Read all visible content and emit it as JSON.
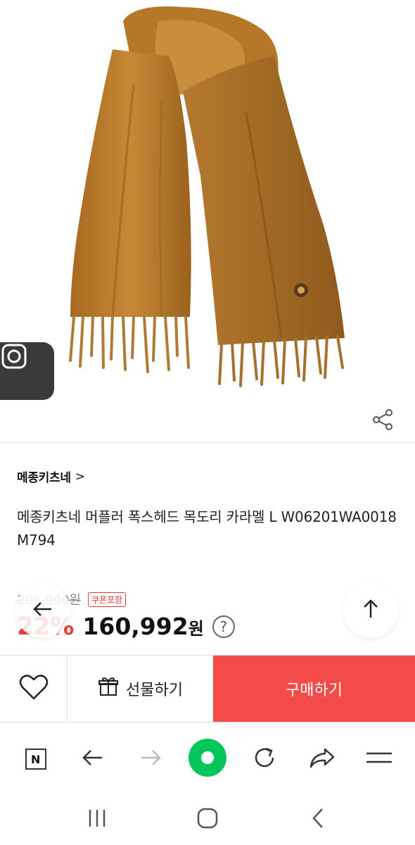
{
  "product": {
    "brand": "메종키츠네",
    "brand_chevron": ">",
    "title": "메종키츠네 머플러 폭스헤드 목도리 카라멜 L W06201WA0018 M794",
    "original_price": "206,990원",
    "coupon_badge": "쿠폰포함",
    "discount": "22%",
    "final_price": "160,992",
    "currency": "원",
    "help_symbol": "?"
  },
  "actions": {
    "gift_label": "선물하기",
    "buy_label": "구매하기"
  },
  "colors": {
    "buy_button": "#f34a4a",
    "discount_text": "#f03c3c",
    "browser_home": "#03c75a",
    "scarf": "#b9782c"
  },
  "icons": {
    "lens": "camera-lens-icon",
    "share": "share-icon",
    "back": "arrow-left-icon",
    "scroll_top": "arrow-up-icon",
    "wish": "heart-icon",
    "gift": "gift-icon",
    "browser": [
      "naver-n-icon",
      "back-arrow-icon",
      "forward-arrow-icon",
      "home-green-icon",
      "refresh-icon",
      "share-arrow-icon",
      "menu-icon"
    ],
    "system": [
      "recent-apps-icon",
      "home-icon",
      "back-icon"
    ]
  },
  "browser_logo": "N"
}
